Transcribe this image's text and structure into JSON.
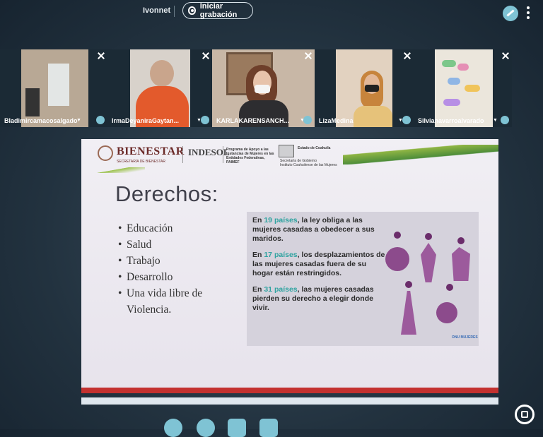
{
  "topbar": {
    "user_name": "Ivonnet",
    "record_label": "Iniciar grabación"
  },
  "participants": [
    {
      "name": "Bladimircamacosalgado",
      "bg": "#b9aa98"
    },
    {
      "name": "IrmaDeyaniraGaytan...",
      "bg": "#cfc6bd"
    },
    {
      "name": "KARLAKARENSANCH...",
      "bg": "#c9b9a9"
    },
    {
      "name": "LizaMedina",
      "bg": "#d9c4ad"
    },
    {
      "name": "Silvianavarroalvarado",
      "bg": "#e4e0d8"
    }
  ],
  "slide": {
    "header": {
      "bienestar": "BIENESTAR",
      "bienestar_sub": "SECRETARÍA DE BIENESTAR",
      "indesol": "INDESOL",
      "paimef": "Programa de Apoyo a las Instancias de Mujeres en las Entidades Federativas, PAIMEF",
      "estado": "Estado de Coahuila",
      "secretaria": "Secretaría de Gobierno",
      "instituto": "Instituto Coahuilense de las Mujeres"
    },
    "title": "Derechos:",
    "bullets": [
      "Educación",
      "Salud",
      "Trabajo",
      "Desarrollo",
      "Una vida libre de Violencia."
    ],
    "facts": [
      {
        "highlight": "19 países",
        "pre": "En ",
        "post": ", la ley obliga a las mujeres casadas a obedecer a sus maridos."
      },
      {
        "highlight": "17 países",
        "pre": "En ",
        "post": ", los desplazamientos de las mujeres casadas fuera de su hogar están restringidos."
      },
      {
        "highlight": "31 países",
        "pre": "En ",
        "post": ", las mujeres casadas pierden su derecho a elegir donde vivir."
      }
    ],
    "brand": "ONU MUJERES"
  },
  "colors": {
    "accent": "#7fc3d4",
    "highlight": "#2fa3a0",
    "figure": "#8c4b8c",
    "slide_bar": "#c3312f"
  },
  "controls": [
    "mic-icon",
    "phone-icon",
    "camera-icon",
    "screen-share-icon"
  ]
}
